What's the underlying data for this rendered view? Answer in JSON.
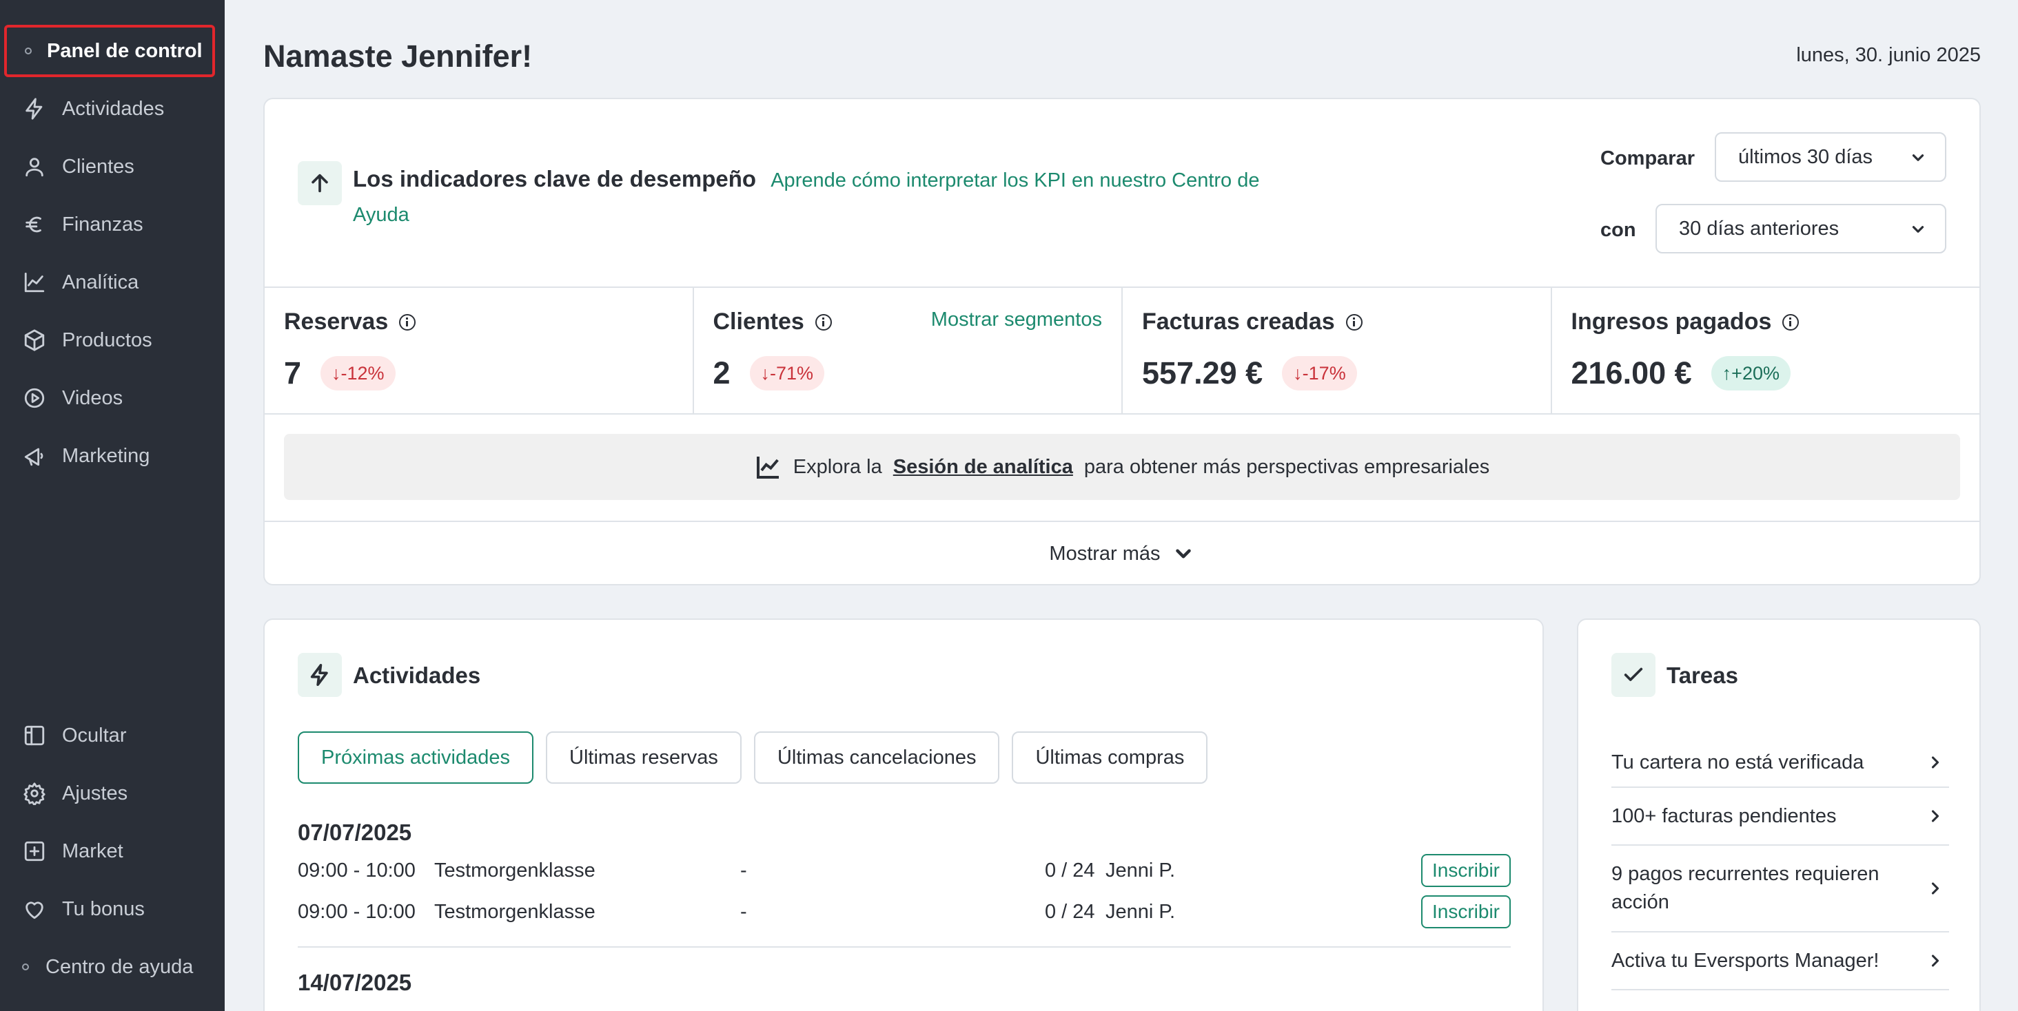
{
  "sidebar": {
    "active_item": "Panel de control",
    "items": [
      {
        "label": "Actividades",
        "icon": "bolt-icon"
      },
      {
        "label": "Clientes",
        "icon": "user-icon"
      },
      {
        "label": "Finanzas",
        "icon": "euro-icon"
      },
      {
        "label": "Analítica",
        "icon": "chart-line-icon"
      },
      {
        "label": "Productos",
        "icon": "box-icon"
      },
      {
        "label": "Videos",
        "icon": "play-icon"
      },
      {
        "label": "Marketing",
        "icon": "megaphone-icon"
      }
    ],
    "bottom_items": [
      {
        "label": "Ocultar",
        "icon": "layout-icon"
      },
      {
        "label": "Ajustes",
        "icon": "gear-icon"
      },
      {
        "label": "Market",
        "icon": "plus-square-icon"
      },
      {
        "label": "Tu bonus",
        "icon": "heart-icon"
      }
    ],
    "help_label": "Centro de ayuda"
  },
  "header": {
    "greeting": "Namaste Jennifer!",
    "date": "lunes, 30. junio 2025"
  },
  "kpi": {
    "title": "Los indicadores clave de desempeño",
    "help_link": "Aprende cómo interpretar los KPI en nuestro Centro de Ayuda",
    "compare_label": "Comparar",
    "compare_value": "últimos 30 días",
    "with_label": "con",
    "with_value": "30 días anteriores",
    "metrics": [
      {
        "name": "Reservas",
        "value": "7",
        "change": "↓-12%",
        "trend": "down"
      },
      {
        "name": "Clientes",
        "value": "2",
        "change": "↓-71%",
        "trend": "down",
        "link": "Mostrar segmentos"
      },
      {
        "name": "Facturas creadas",
        "value": "557.29 €",
        "change": "↓-17%",
        "trend": "down"
      },
      {
        "name": "Ingresos pagados",
        "value": "216.00 €",
        "change": "↑+20%",
        "trend": "up"
      }
    ],
    "explore_prefix": "Explora la",
    "explore_link": "Sesión de analítica",
    "explore_suffix": "para obtener más perspectivas empresariales",
    "show_more": "Mostrar más"
  },
  "activities": {
    "title": "Actividades",
    "tabs": [
      "Próximas actividades",
      "Últimas reservas",
      "Últimas cancelaciones",
      "Últimas compras"
    ],
    "days": [
      {
        "date": "07/07/2025",
        "rows": [
          {
            "time": "09:00 - 10:00",
            "name": "Testmorgenklasse",
            "dash": "-",
            "capacity": "0 / 24",
            "instructor": "Jenni P.",
            "action": "Inscribir"
          },
          {
            "time": "09:00 - 10:00",
            "name": "Testmorgenklasse",
            "dash": "-",
            "capacity": "0 / 24",
            "instructor": "Jenni P.",
            "action": "Inscribir"
          }
        ]
      },
      {
        "date": "14/07/2025"
      }
    ]
  },
  "tasks": {
    "title": "Tareas",
    "items": [
      "Tu cartera no está verificada",
      "100+ facturas pendientes",
      "9 pagos recurrentes requieren acción",
      "Activa tu Eversports Manager!"
    ]
  }
}
